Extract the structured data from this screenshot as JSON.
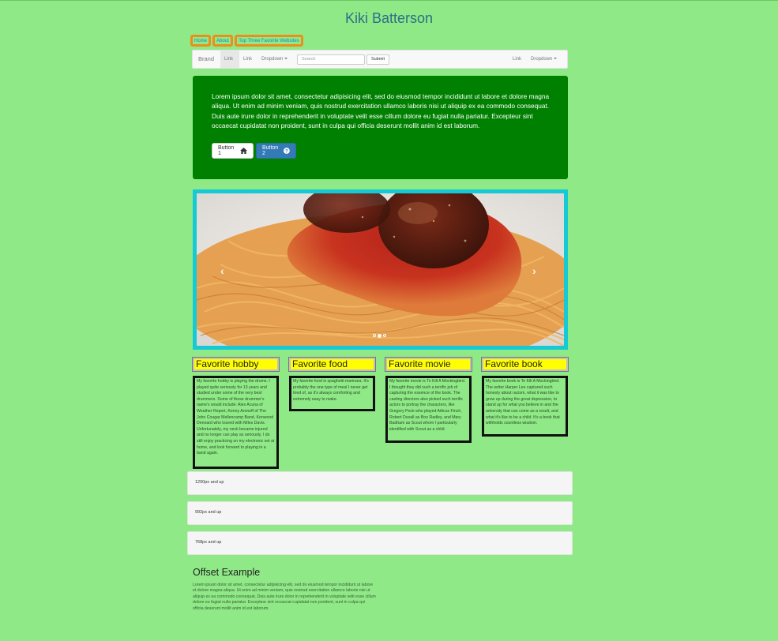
{
  "page": {
    "title": "Kiki Batterson",
    "colors": {
      "background": "#8ee986",
      "jumbotron": "#008000",
      "carousel_border": "#15c9d6",
      "favorite_header": "#ffff00",
      "pill_border": "#f08c1c"
    }
  },
  "pill_nav": [
    "Home",
    "About",
    "Top Three Favorite Websites"
  ],
  "navbar": {
    "brand": "Brand",
    "links": [
      "Link",
      "Link"
    ],
    "dropdown": "Dropdown",
    "search_placeholder": "Search",
    "submit": "Submit",
    "right_link": "Link",
    "right_dropdown": "Dropdown"
  },
  "jumbotron": {
    "text": "Lorem ipsum dolor sit amet, consectetur adipisicing elit, sed do eiusmod tempor incididunt ut labore et dolore magna aliqua. Ut enim ad minim veniam, quis nostrud exercitation ullamco laboris nisi ut aliquip ex ea commodo consequat. Duis aute irure dolor in reprehenderit in voluptate velit esse cillum dolore eu fugiat nulla pariatur. Excepteur sint occaecat cupidatat non proident, sunt in culpa qui officia deserunt mollit anim id est laborum.",
    "button1": "Button 1",
    "button1_icon": "home-icon",
    "button2": "Button 2",
    "button2_icon": "question-circle-icon"
  },
  "carousel": {
    "image": "spaghetti-and-meatballs",
    "indicator_count": 3,
    "active_indicator": 2
  },
  "favorites": [
    {
      "title": "Favorite hobby",
      "text": "My favorite hobby is playing the drums. I played quite seriously for 13 years and studied under some of the very best drummers. Some of these drummer's name's would include: Alex Acuna of Weather Report, Kenny Aronoff of The John Cougar Mellencamp Band, Kenwood Dennard who toured with Miles Davis. Unfortunately, my neck became injured and no longer can play as seriously. I do still enjoy practicing on my electronic set at home, and look forward to playing in a band again."
    },
    {
      "title": "Favorite food",
      "text": "My favorite food is spaghetti marinara. It's probably the one type of meal I never get tired of, as it's always comforting and extremely easy to make."
    },
    {
      "title": "Favorite movie",
      "text": "My favorite movie is To Kill A Mockingbird. I thought they did such a terrific job of capturing the essence of the book. The casting directors also picked such terrific actors to portray the characters, like Gregory Peck who played Atticus Finch, Robert Duvall as Boo Radley, and Mary Badham as Scout whom I particularly identified with Scout as a child."
    },
    {
      "title": "Favorite book",
      "text": "My favorite book is To Kill A Mockingbird. The writer Harper Lee captured such honesty about racism, what it was like to grow up during the great depression, to stand up for what you believe in and the adversity that can come as a result, and what it's like to be a child. It's a book that withholds countless wisdom."
    }
  ],
  "wells": [
    "1200px and up",
    "992px and up",
    "768px and up"
  ],
  "offset": {
    "title": "Offset Example",
    "text": "Lorem ipsum dolor sit amet, consectetur adipisicing elit, sed do eiusmod tempor incididunt ut labore et dolore magna aliqua. Ut enim ad minim veniam, quis nostrud exercitation ullamco laboris nisi ut aliquip ex ea commodo consequat. Duis aute irure dolor in reprehenderit in voluptate velit esse cillum dolore eu fugiat nulla pariatur. Excepteur sint occaecat cupidatat non proident, sunt in culpa qui officia deserunt mollit anim id est laborum."
  }
}
